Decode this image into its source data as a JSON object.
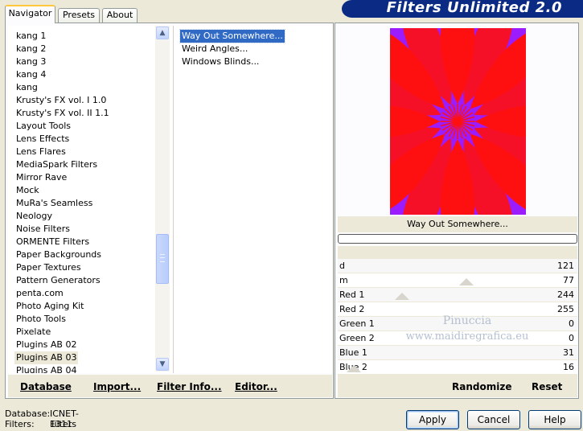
{
  "app": {
    "title": "Filters Unlimited 2.0"
  },
  "tabs": [
    {
      "label": "Navigator",
      "active": true
    },
    {
      "label": "Presets",
      "active": false
    },
    {
      "label": "About",
      "active": false
    }
  ],
  "categories": [
    "kang 1",
    "kang 2",
    "kang 3",
    "kang 4",
    "kang",
    "Krusty's FX vol. I 1.0",
    "Krusty's FX vol. II 1.1",
    "Layout Tools",
    "Lens Effects",
    "Lens Flares",
    "MediaSpark Filters",
    "Mirror Rave",
    "Mock",
    "MuRa's Seamless",
    "Neology",
    "Noise Filters",
    "ORMENTE Filters",
    "Paper Backgrounds",
    "Paper Textures",
    "Pattern Generators",
    "penta.com",
    "Photo Aging Kit",
    "Photo Tools",
    "Pixelate",
    "Plugins AB 02",
    "Plugins AB 03",
    "Plugins AB 04"
  ],
  "selected_category": "Plugins AB 03",
  "filters": [
    "Way Out Somewhere...",
    "Weird Angles...",
    "Windows Blinds..."
  ],
  "selected_filter": "Way Out Somewhere...",
  "left_buttons": {
    "database": "Database",
    "import": "Import...",
    "filter_info": "Filter Info...",
    "editor": "Editor..."
  },
  "preview": {
    "caption": "Way Out Somewhere...",
    "progress": 0
  },
  "params": [
    {
      "name": "d",
      "value": "121"
    },
    {
      "name": "m",
      "value": "77"
    },
    {
      "name": "Red 1",
      "value": "244"
    },
    {
      "name": "Red 2",
      "value": "255"
    },
    {
      "name": "Green 1",
      "value": "0"
    },
    {
      "name": "Green 2",
      "value": "0"
    },
    {
      "name": "Blue 1",
      "value": "31"
    },
    {
      "name": "Blue 2",
      "value": "16"
    }
  ],
  "watermark": {
    "line1": "Pinuccia",
    "line2": "www.maidiregrafica.eu"
  },
  "right_buttons": {
    "randomize": "Randomize",
    "reset": "Reset"
  },
  "status": {
    "database_label": "Database:",
    "database_value": "ICNET-Filters",
    "filters_label": "Filters:",
    "filters_value": "1311"
  },
  "dialog_buttons": {
    "apply": "Apply",
    "cancel": "Cancel",
    "help": "Help"
  },
  "colors": {
    "banner": "#0a2a83",
    "selection": "#316ac5",
    "preview_bg": "#9b1cff",
    "preview_petal": "#ff1010"
  }
}
